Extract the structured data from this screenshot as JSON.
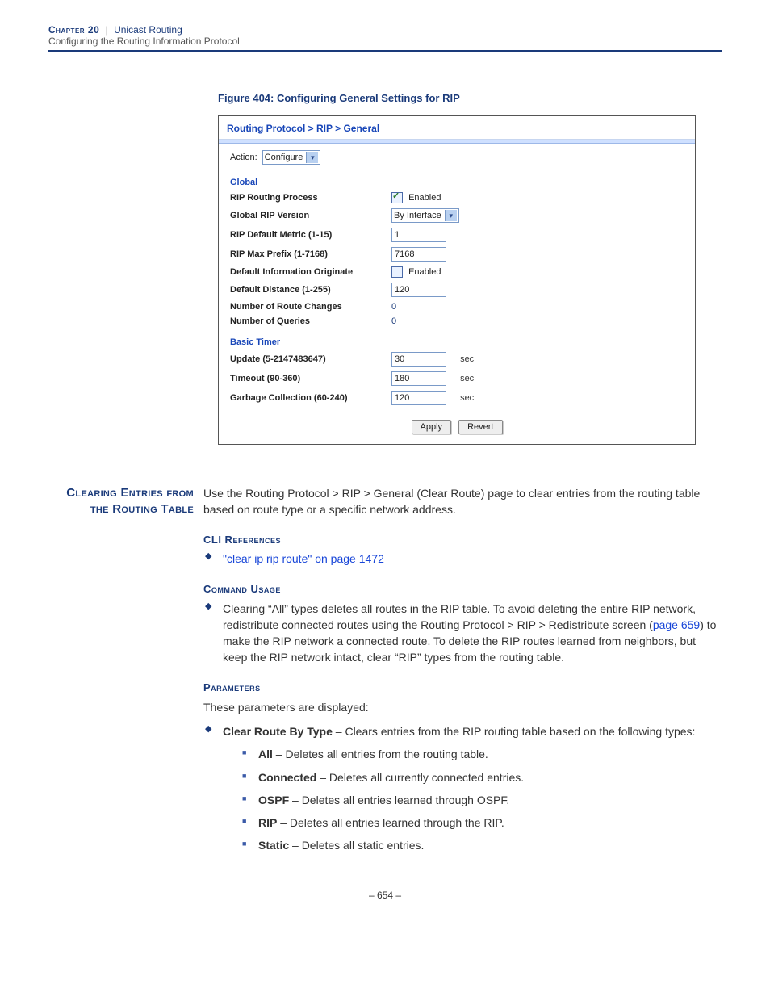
{
  "header": {
    "chapter": "Chapter 20",
    "section": "Unicast Routing",
    "subsection": "Configuring the Routing Information Protocol"
  },
  "figure": {
    "caption": "Figure 404:  Configuring General Settings for RIP"
  },
  "screenshot": {
    "breadcrumb": "Routing Protocol > RIP > General",
    "action_label": "Action:",
    "action_value": "Configure",
    "global_title": "Global",
    "rows": {
      "rip_process_label": "RIP Routing Process",
      "rip_process_enabled_text": "Enabled",
      "global_ver_label": "Global RIP Version",
      "global_ver_value": "By Interface",
      "def_metric_label": "RIP Default Metric (1-15)",
      "def_metric_value": "1",
      "max_prefix_label": "RIP Max Prefix (1-7168)",
      "max_prefix_value": "7168",
      "def_info_label": "Default Information Originate",
      "def_info_enabled_text": "Enabled",
      "def_dist_label": "Default Distance (1-255)",
      "def_dist_value": "120",
      "route_changes_label": "Number of Route Changes",
      "route_changes_value": "0",
      "queries_label": "Number of Queries",
      "queries_value": "0"
    },
    "timer_title": "Basic Timer",
    "timer": {
      "update_label": "Update (5-2147483647)",
      "update_value": "30",
      "timeout_label": "Timeout (90-360)",
      "timeout_value": "180",
      "gc_label": "Garbage Collection (60-240)",
      "gc_value": "120",
      "unit": "sec"
    },
    "apply": "Apply",
    "revert": "Revert"
  },
  "margin_heading": "Clearing Entries from the Routing Table",
  "intro": "Use the Routing Protocol > RIP > General (Clear Route) page to clear entries from the routing table based on route type or a specific network address.",
  "cli_head": "CLI References",
  "cli_link": "\"clear ip rip route\" on page 1472",
  "usage_head": "Command Usage",
  "usage_text_a": "Clearing “All” types deletes all routes in the RIP table. To avoid deleting the entire RIP network, redistribute connected routes using the Routing Protocol > RIP > Redistribute screen (",
  "usage_link": "page 659",
  "usage_text_b": ") to make the RIP network a connected route. To delete the RIP routes learned from neighbors, but keep the RIP network intact, clear “RIP” types from the routing table.",
  "params_head": "Parameters",
  "params_intro": "These parameters are displayed:",
  "param_main_label": "Clear Route By Type",
  "param_main_desc": " – Clears entries from the RIP routing table based on the following types:",
  "subs": [
    {
      "label": "All",
      "desc": " – Deletes all entries from the routing table."
    },
    {
      "label": "Connected",
      "desc": " – Deletes all currently connected entries."
    },
    {
      "label": "OSPF",
      "desc": " – Deletes all entries learned through OSPF."
    },
    {
      "label": "RIP",
      "desc": " – Deletes all entries learned through the RIP."
    },
    {
      "label": "Static",
      "desc": " – Deletes all static entries."
    }
  ],
  "page_number": "– 654 –"
}
